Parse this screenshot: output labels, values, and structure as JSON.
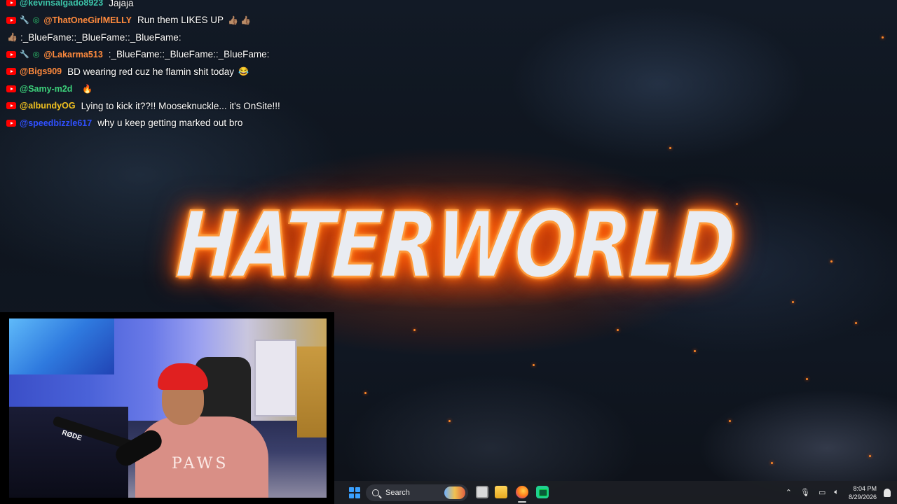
{
  "wallpaper": {
    "title": "HATERWORLD",
    "fire_color": "#ff6a00"
  },
  "chat": {
    "messages": [
      {
        "user": "@kevinsalgado8923",
        "user_color": "#3cc3a8",
        "text": "Jajaja",
        "emoji": "",
        "badges": [
          "youtube"
        ]
      },
      {
        "user": "@ThatOneGirlMELLY",
        "user_color": "#ff8a3d",
        "text": "Run them LIKES UP",
        "emoji": "👍🏽 👍🏽",
        "badges": [
          "youtube",
          "tool",
          "mod"
        ]
      },
      {
        "user": "",
        "user_color": "#ffffff",
        "text": ":_BlueFame::_BlueFame::_BlueFame:",
        "emoji": "👍🏽",
        "badges": []
      },
      {
        "user": "@Lakarma513",
        "user_color": "#ff8a3d",
        "text": ":_BlueFame::_BlueFame::_BlueFame:",
        "emoji": "",
        "badges": [
          "youtube",
          "tool",
          "mod"
        ]
      },
      {
        "user": "@Bigs909",
        "user_color": "#ff8a3d",
        "text": "BD wearing red cuz he flamin shit today",
        "emoji": "😂",
        "badges": [
          "youtube"
        ]
      },
      {
        "user": "@Samy-m2d",
        "user_color": "#3cd07a",
        "text": "",
        "emoji": "🔥",
        "badges": [
          "youtube"
        ]
      },
      {
        "user": "@albundyOG",
        "user_color": "#f0c020",
        "text": "Lying to kick it??!! Mooseknuckle... it's OnSite!!!",
        "emoji": "",
        "badges": [
          "youtube"
        ]
      },
      {
        "user": "@speedbizzle617",
        "user_color": "#3050ff",
        "text": "why u keep getting marked out bro",
        "emoji": "",
        "badges": [
          "youtube"
        ]
      }
    ]
  },
  "webcam": {
    "mic_brand": "RØDE",
    "shirt_text": "PAWS"
  },
  "taskbar": {
    "search_label": "Search",
    "time": "8:04 PM",
    "date": "8/29/2026",
    "accent": "#3aa0ff"
  }
}
